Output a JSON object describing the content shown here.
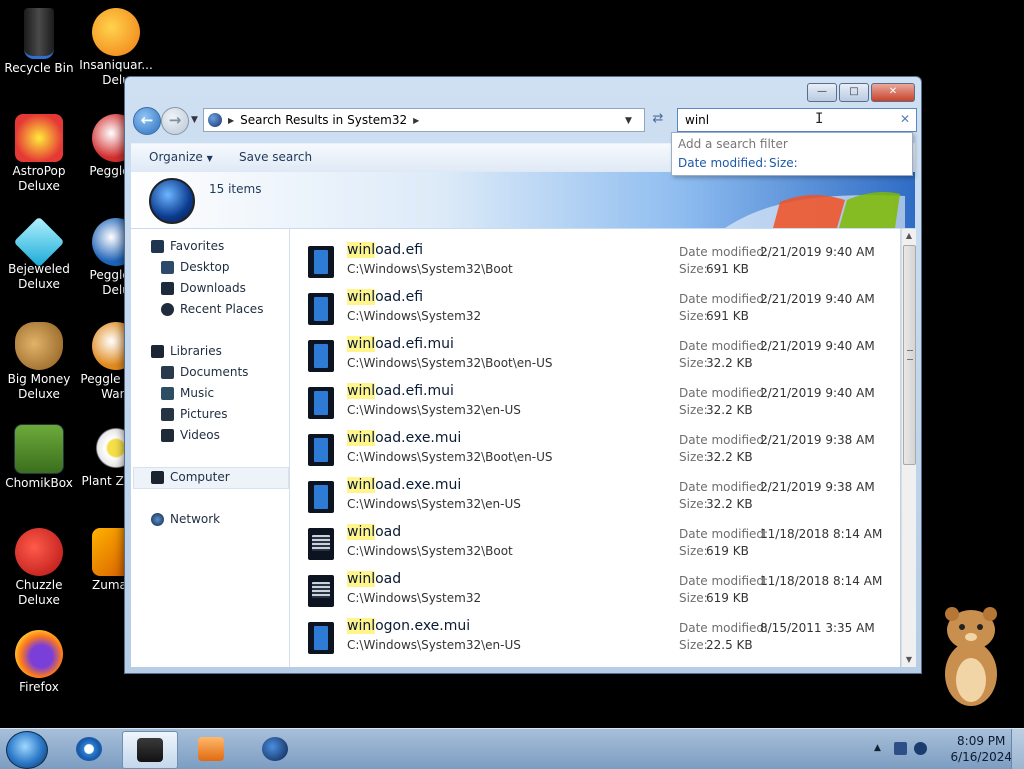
{
  "desktop": {
    "icons": [
      {
        "label": "Recycle Bin"
      },
      {
        "label": "Insaniquar... Delu"
      },
      {
        "label": "AstroPop Deluxe"
      },
      {
        "label": "Peggle D"
      },
      {
        "label": "Bejeweled Deluxe"
      },
      {
        "label": "Peggle N Delu"
      },
      {
        "label": "Big Money Deluxe"
      },
      {
        "label": "Peggle W of Warc"
      },
      {
        "label": "ChomikBox"
      },
      {
        "label": "Plant Zomb"
      },
      {
        "label": "Chuzzle Deluxe"
      },
      {
        "label": "Zuma D"
      },
      {
        "label": "Firefox"
      }
    ]
  },
  "window": {
    "address_crumb": "Search Results in System32",
    "search_value": "winl",
    "toolbar": {
      "organize": "Organize",
      "save_search": "Save search"
    },
    "item_count": "15 items",
    "search_suggest": {
      "title": "Add a search filter",
      "filter_date": "Date modified:",
      "filter_size": "Size:"
    },
    "nav": {
      "favorites": "Favorites",
      "desktop": "Desktop",
      "downloads": "Downloads",
      "recent": "Recent Places",
      "libraries": "Libraries",
      "documents": "Documents",
      "music": "Music",
      "pictures": "Pictures",
      "videos": "Videos",
      "computer": "Computer",
      "network": "Network"
    },
    "labels": {
      "date_modified": "Date modified:",
      "size": "Size:"
    },
    "files": [
      {
        "match": "winl",
        "rest": "oad.efi",
        "path": "C:\\Windows\\System32\\Boot",
        "date": "2/21/2019 9:40 AM",
        "size": "691 KB",
        "kind": "doc"
      },
      {
        "match": "winl",
        "rest": "oad.efi",
        "path": "C:\\Windows\\System32",
        "date": "2/21/2019 9:40 AM",
        "size": "691 KB",
        "kind": "doc"
      },
      {
        "match": "winl",
        "rest": "oad.efi.mui",
        "path": "C:\\Windows\\System32\\Boot\\en-US",
        "date": "2/21/2019 9:40 AM",
        "size": "32.2 KB",
        "kind": "doc"
      },
      {
        "match": "winl",
        "rest": "oad.efi.mui",
        "path": "C:\\Windows\\System32\\en-US",
        "date": "2/21/2019 9:40 AM",
        "size": "32.2 KB",
        "kind": "doc"
      },
      {
        "match": "winl",
        "rest": "oad.exe.mui",
        "path": "C:\\Windows\\System32\\Boot\\en-US",
        "date": "2/21/2019 9:38 AM",
        "size": "32.2 KB",
        "kind": "doc"
      },
      {
        "match": "winl",
        "rest": "oad.exe.mui",
        "path": "C:\\Windows\\System32\\en-US",
        "date": "2/21/2019 9:38 AM",
        "size": "32.2 KB",
        "kind": "doc"
      },
      {
        "match": "winl",
        "rest": "oad",
        "path": "C:\\Windows\\System32\\Boot",
        "date": "11/18/2018 8:14 AM",
        "size": "619 KB",
        "kind": "sys"
      },
      {
        "match": "winl",
        "rest": "oad",
        "path": "C:\\Windows\\System32",
        "date": "11/18/2018 8:14 AM",
        "size": "619 KB",
        "kind": "sys"
      },
      {
        "match": "winl",
        "rest": "ogon.exe.mui",
        "path": "C:\\Windows\\System32\\en-US",
        "date": "8/15/2011 3:35 AM",
        "size": "22.5 KB",
        "kind": "doc"
      }
    ]
  },
  "taskbar": {
    "time": "8:09 PM",
    "date": "6/16/2024"
  },
  "colors": {
    "highlight": "#fff58a",
    "link_blue": "#1e5aa8",
    "taskbar": "#7c9dc2"
  }
}
